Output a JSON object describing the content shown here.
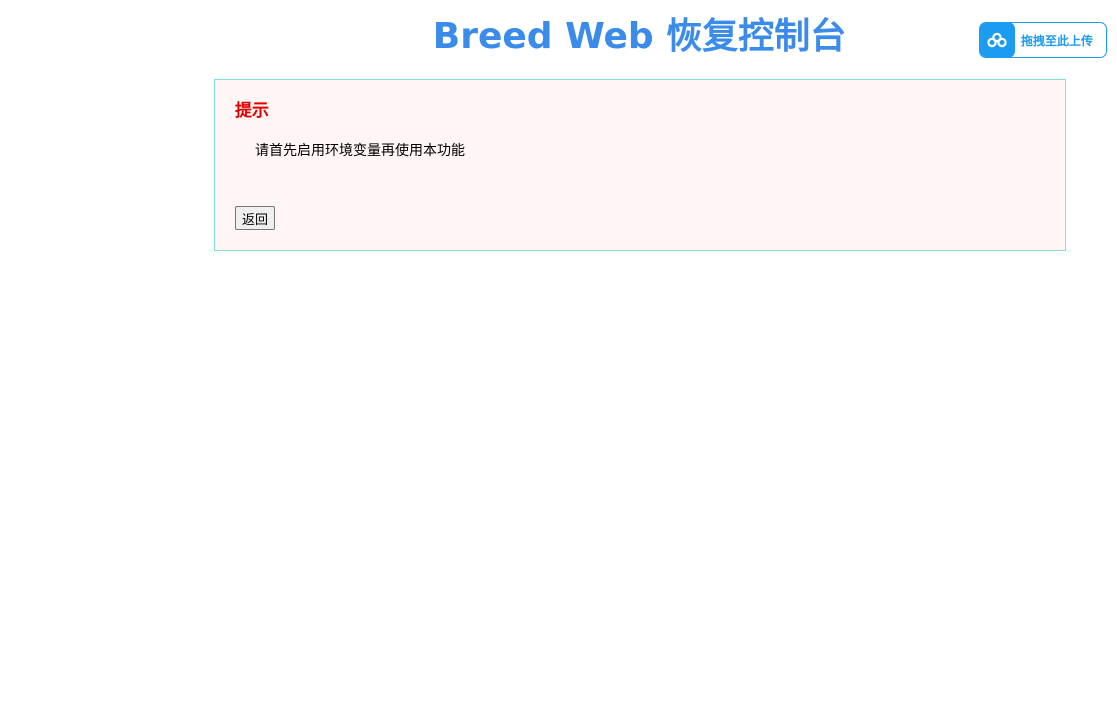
{
  "header": {
    "title": "Breed Web 恢复控制台",
    "title_color": "#3b8beb"
  },
  "upload_widget": {
    "label": "拖拽至此上传",
    "icon": "cloud-upload-icon",
    "accent_color": "#1c9cf0"
  },
  "notice": {
    "title": "提示",
    "title_color": "#e00000",
    "message": "请首先启用环境变量再使用本功能",
    "background_color": "#fff6f5",
    "border_color": "#7fe3cf",
    "back_button_label": "返回"
  }
}
